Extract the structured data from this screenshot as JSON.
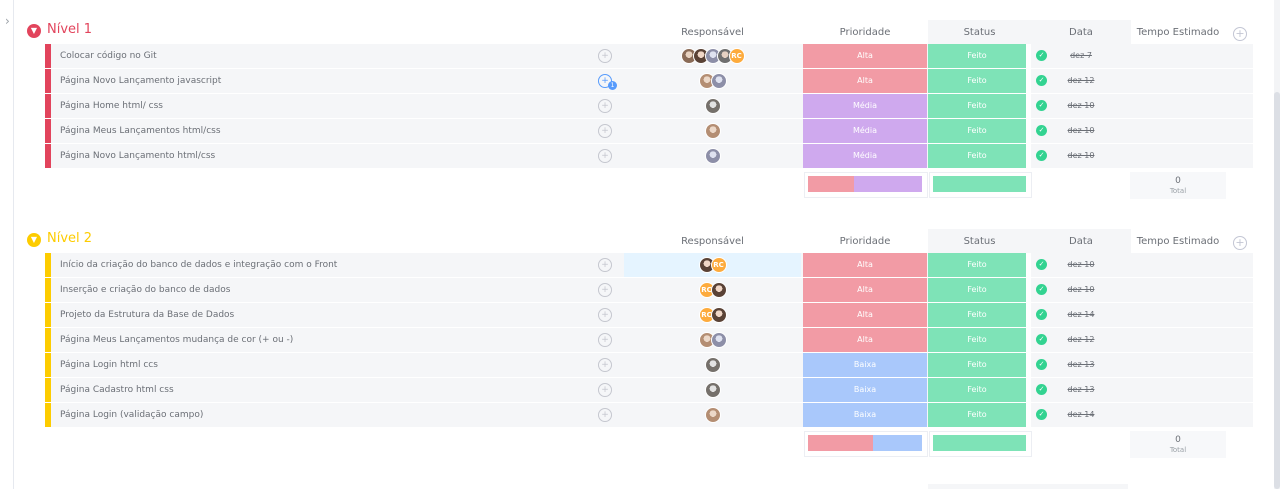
{
  "colors": {
    "alta": "#f29ba5",
    "media": "#cfa9ee",
    "baixa": "#a9c8fb",
    "feito": "#7ee3b7",
    "group1": "#e2445c",
    "group2": "#fdcc00",
    "check": "#33d391"
  },
  "columns": {
    "responsavel": "Responsável",
    "prioridade": "Prioridade",
    "status": "Status",
    "data": "Data",
    "tempo": "Tempo Estimado"
  },
  "groups": [
    {
      "title": "Nível 1",
      "total_value": "0",
      "total_label": "Total",
      "rows": [
        {
          "task": "Colocar código no Git",
          "priority": "Alta",
          "status": "Feito",
          "date": "dez 7",
          "avatars": [
            "a1",
            "a2",
            "a3",
            "a4",
            "RC"
          ],
          "comment_badge": ""
        },
        {
          "task": "Página Novo Lançamento javascript",
          "priority": "Alta",
          "status": "Feito",
          "date": "dez 12",
          "avatars": [
            "a6",
            "a3"
          ],
          "comment_badge": "1"
        },
        {
          "task": "Página Home html/ css",
          "priority": "Média",
          "status": "Feito",
          "date": "dez 10",
          "avatars": [
            "a5"
          ],
          "comment_badge": ""
        },
        {
          "task": "Página Meus Lançamentos html/css",
          "priority": "Média",
          "status": "Feito",
          "date": "dez 10",
          "avatars": [
            "a6"
          ],
          "comment_badge": ""
        },
        {
          "task": "Página Novo Lançamento html/css",
          "priority": "Média",
          "status": "Feito",
          "date": "dez 10",
          "avatars": [
            "a3"
          ],
          "comment_badge": ""
        }
      ],
      "priority_summary": [
        {
          "label": "Alta",
          "fraction": 0.4
        },
        {
          "label": "Média",
          "fraction": 0.6
        }
      ],
      "status_summary": [
        {
          "label": "Feito",
          "fraction": 1.0
        }
      ]
    },
    {
      "title": "Nível 2",
      "total_value": "0",
      "total_label": "Total",
      "rows": [
        {
          "task": "Início da criação do banco de dados e integração com o Front",
          "priority": "Alta",
          "status": "Feito",
          "date": "dez 10",
          "avatars": [
            "a2",
            "RC"
          ],
          "comment_badge": ""
        },
        {
          "task": "Inserção e criação do banco de dados",
          "priority": "Alta",
          "status": "Feito",
          "date": "dez 10",
          "avatars": [
            "RC",
            "a2"
          ],
          "comment_badge": ""
        },
        {
          "task": "Projeto da Estrutura da Base de Dados",
          "priority": "Alta",
          "status": "Feito",
          "date": "dez 14",
          "avatars": [
            "RC",
            "a2"
          ],
          "comment_badge": ""
        },
        {
          "task": "Página Meus Lançamentos mudança de cor (+ ou -)",
          "priority": "Alta",
          "status": "Feito",
          "date": "dez 12",
          "avatars": [
            "a6",
            "a3"
          ],
          "comment_badge": ""
        },
        {
          "task": "Página Login html ccs",
          "priority": "Baixa",
          "status": "Feito",
          "date": "dez 13",
          "avatars": [
            "a5"
          ],
          "comment_badge": ""
        },
        {
          "task": "Página Cadastro html css",
          "priority": "Baixa",
          "status": "Feito",
          "date": "dez 13",
          "avatars": [
            "a5"
          ],
          "comment_badge": ""
        },
        {
          "task": "Página Login (validação campo)",
          "priority": "Baixa",
          "status": "Feito",
          "date": "dez 14",
          "avatars": [
            "a6"
          ],
          "comment_badge": ""
        }
      ],
      "priority_summary": [
        {
          "label": "Alta",
          "fraction": 0.57
        },
        {
          "label": "Baixa",
          "fraction": 0.43
        }
      ],
      "status_summary": [
        {
          "label": "Feito",
          "fraction": 1.0
        }
      ]
    }
  ]
}
